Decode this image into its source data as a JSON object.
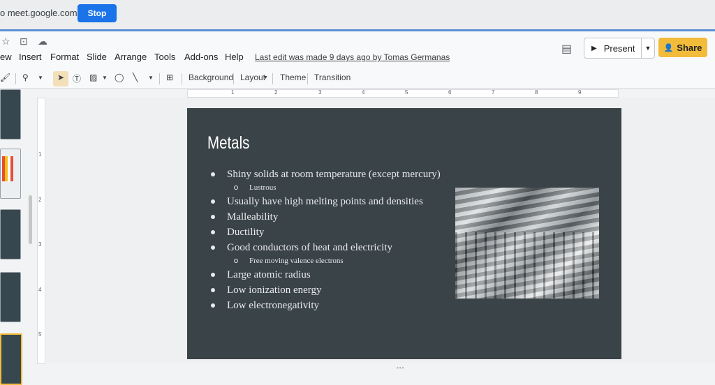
{
  "sharing_bar": {
    "text": "o meet.google.com",
    "stop_label": "Stop"
  },
  "menu": [
    "ew",
    "Insert",
    "Format",
    "Slide",
    "Arrange",
    "Tools",
    "Add-ons",
    "Help"
  ],
  "last_edit": "Last edit was made 9 days ago by Tomas Germanas",
  "header": {
    "present_label": "Present",
    "share_label": "Share"
  },
  "toolbar": {
    "background": "Background",
    "layout": "Layout",
    "theme": "Theme",
    "transition": "Transition"
  },
  "ruler_h": [
    "1",
    "2",
    "3",
    "4",
    "5",
    "6",
    "7",
    "8",
    "9"
  ],
  "ruler_v": [
    "1",
    "2",
    "3",
    "4",
    "5"
  ],
  "slide": {
    "title": "Metals",
    "bullets": [
      {
        "level": 1,
        "text": "Shiny solids at room temperature (except mercury)"
      },
      {
        "level": 2,
        "text": "Lustrous"
      },
      {
        "level": 1,
        "text": "Usually have high melting points and densities"
      },
      {
        "level": 1,
        "text": "Malleability"
      },
      {
        "level": 1,
        "text": "Ductility"
      },
      {
        "level": 1,
        "text": "Good conductors of heat and electricity"
      },
      {
        "level": 2,
        "text": "Free moving valence electrons"
      },
      {
        "level": 1,
        "text": "Large atomic radius"
      },
      {
        "level": 1,
        "text": "Low ionization energy"
      },
      {
        "level": 1,
        "text": "Low electronegativity"
      }
    ]
  },
  "colors": {
    "slide_bg": "#3a4347",
    "share_button": "#f2bb3a",
    "stop_button": "#1a73e8"
  }
}
